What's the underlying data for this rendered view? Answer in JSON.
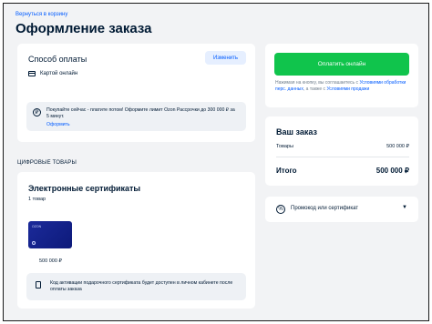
{
  "header": {
    "back_link": "Вернуться в корзину",
    "title": "Оформление заказа"
  },
  "payment": {
    "title": "Способ оплаты",
    "change_label": "Изменить",
    "method_label": "Картой онлайн",
    "promo_text": "Покупайте сейчас - платите потом! Оформите лимит Ozon Рассрочки до 300 000 ₽ за 5 минут.",
    "promo_link": "Оформить",
    "ruble_symbol": "₽"
  },
  "digital": {
    "section_label": "ЦИФРОВЫЕ ТОВАРЫ",
    "title": "Электронные сертификаты",
    "count": "1 товар",
    "card_logo": "OZON",
    "price": "500 000 ₽",
    "info_text": "Код активации подарочного сертификата будет доступен в личном кабинете после оплаты заказа"
  },
  "checkout": {
    "pay_button": "Оплатить онлайн",
    "consent_prefix": "Нажимая на кнопку, вы соглашаетесь с ",
    "consent_link1": "Условиями обработки перс. данных",
    "consent_mid": ", а также с ",
    "consent_link2": "Условиями продажи"
  },
  "order": {
    "title": "Ваш заказ",
    "goods_label": "Товары",
    "goods_value": "500 000 ₽",
    "total_label": "Итого",
    "total_value": "500 000 ₽"
  },
  "promo_code": {
    "label": "Промокод или сертификат",
    "percent_symbol": "%",
    "chevron": "▼"
  },
  "colors": {
    "accent": "#005bff",
    "pay_button": "#10c44c",
    "background": "#f2f3f5",
    "gift_card": "#1b2a9a"
  }
}
